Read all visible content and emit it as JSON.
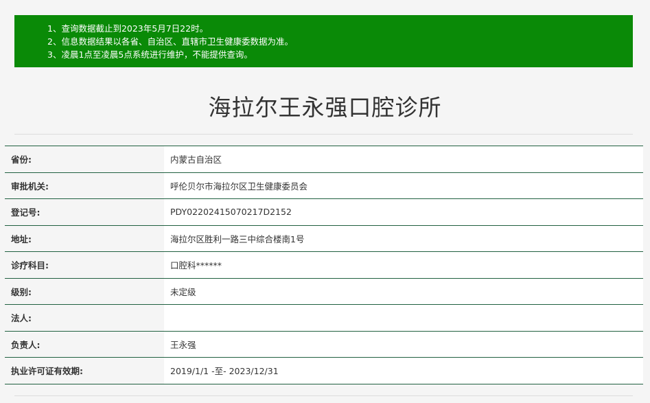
{
  "notice": {
    "lines": [
      "1、查询数据截止到2023年5月7日22时。",
      "2、信息数据结果以各省、自治区、直辖市卫生健康委数据为准。",
      "3、凌晨1点至凌晨5点系统进行维护，不能提供查询。"
    ]
  },
  "title": "海拉尔王永强口腔诊所",
  "rows": [
    {
      "label": "省份:",
      "value": "内蒙古自治区"
    },
    {
      "label": "审批机关:",
      "value": "呼伦贝尔市海拉尔区卫生健康委员会"
    },
    {
      "label": "登记号:",
      "value": "PDY02202415070217D2152"
    },
    {
      "label": "地址:",
      "value": "海拉尔区胜利一路三中综合楼南1号"
    },
    {
      "label": "诊疗科目:",
      "value": "口腔科******"
    },
    {
      "label": "级别:",
      "value": "未定级"
    },
    {
      "label": "法人:",
      "value": ""
    },
    {
      "label": "负责人:",
      "value": "王永强"
    },
    {
      "label": "执业许可证有效期:",
      "value": "2019/1/1 -至- 2023/12/31"
    }
  ],
  "colors": {
    "notice_bg": "#0a8a07",
    "row_border": "#1f5f3f",
    "text": "#333333"
  }
}
